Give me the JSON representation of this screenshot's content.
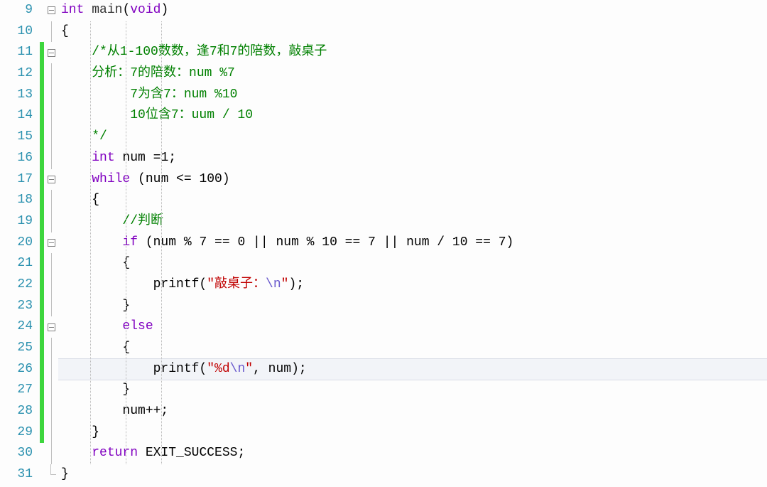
{
  "first_line_number": 9,
  "lines": [
    {
      "num": 9,
      "fold": "box",
      "changed": false,
      "tokens": [
        {
          "t": "int",
          "c": "kw"
        },
        {
          "t": " "
        },
        {
          "t": "main",
          "c": "ident"
        },
        {
          "t": "("
        },
        {
          "t": "void",
          "c": "kw"
        },
        {
          "t": ")"
        }
      ]
    },
    {
      "num": 10,
      "fold": "line",
      "changed": false,
      "tokens": [
        {
          "t": "{"
        }
      ]
    },
    {
      "num": 11,
      "fold": "box",
      "changed": true,
      "tokens": [
        {
          "t": "    "
        },
        {
          "t": "/*从1-100数数，逢7和7的陪数，敲桌子",
          "c": "comment"
        }
      ]
    },
    {
      "num": 12,
      "fold": "line",
      "changed": true,
      "tokens": [
        {
          "t": "    "
        },
        {
          "t": "分析：7的陪数：num %7",
          "c": "comment"
        }
      ]
    },
    {
      "num": 13,
      "fold": "line",
      "changed": true,
      "tokens": [
        {
          "t": "         "
        },
        {
          "t": "7为含7：num %10",
          "c": "comment"
        }
      ]
    },
    {
      "num": 14,
      "fold": "line",
      "changed": true,
      "tokens": [
        {
          "t": "         "
        },
        {
          "t": "10位含7：uum / 10",
          "c": "comment"
        }
      ]
    },
    {
      "num": 15,
      "fold": "line",
      "changed": true,
      "tokens": [
        {
          "t": "    "
        },
        {
          "t": "*/",
          "c": "comment"
        }
      ]
    },
    {
      "num": 16,
      "fold": "line",
      "changed": true,
      "tokens": [
        {
          "t": "    "
        },
        {
          "t": "int",
          "c": "kw"
        },
        {
          "t": " num ="
        },
        {
          "t": "1"
        },
        {
          "t": ";"
        }
      ]
    },
    {
      "num": 17,
      "fold": "box",
      "changed": true,
      "tokens": [
        {
          "t": "    "
        },
        {
          "t": "while",
          "c": "kw"
        },
        {
          "t": " (num <= "
        },
        {
          "t": "100"
        },
        {
          "t": ")"
        }
      ]
    },
    {
      "num": 18,
      "fold": "line",
      "changed": true,
      "tokens": [
        {
          "t": "    {"
        }
      ]
    },
    {
      "num": 19,
      "fold": "line",
      "changed": true,
      "tokens": [
        {
          "t": "        "
        },
        {
          "t": "//判断",
          "c": "comment"
        }
      ]
    },
    {
      "num": 20,
      "fold": "box",
      "changed": true,
      "tokens": [
        {
          "t": "        "
        },
        {
          "t": "if",
          "c": "kw"
        },
        {
          "t": " (num % 7 == 0 || num % 10 == 7 || num / 10 == 7)"
        }
      ]
    },
    {
      "num": 21,
      "fold": "line",
      "changed": true,
      "tokens": [
        {
          "t": "        {"
        }
      ]
    },
    {
      "num": 22,
      "fold": "line",
      "changed": true,
      "tokens": [
        {
          "t": "            printf("
        },
        {
          "t": "\"敲桌子：",
          "c": "str"
        },
        {
          "t": "\\n",
          "c": "esc"
        },
        {
          "t": "\"",
          "c": "str"
        },
        {
          "t": ");"
        }
      ]
    },
    {
      "num": 23,
      "fold": "line",
      "changed": true,
      "tokens": [
        {
          "t": "        }"
        }
      ]
    },
    {
      "num": 24,
      "fold": "box",
      "changed": true,
      "tokens": [
        {
          "t": "        "
        },
        {
          "t": "else",
          "c": "kw"
        }
      ]
    },
    {
      "num": 25,
      "fold": "line",
      "changed": true,
      "tokens": [
        {
          "t": "        {"
        }
      ]
    },
    {
      "num": 26,
      "fold": "line",
      "changed": true,
      "current": true,
      "tokens": [
        {
          "t": "            printf("
        },
        {
          "t": "\"%d",
          "c": "str"
        },
        {
          "t": "\\n",
          "c": "esc"
        },
        {
          "t": "\"",
          "c": "str"
        },
        {
          "t": ", num);"
        }
      ]
    },
    {
      "num": 27,
      "fold": "line",
      "changed": true,
      "tokens": [
        {
          "t": "        }"
        }
      ]
    },
    {
      "num": 28,
      "fold": "line",
      "changed": true,
      "tokens": [
        {
          "t": "        num++;"
        }
      ]
    },
    {
      "num": 29,
      "fold": "line",
      "changed": true,
      "tokens": [
        {
          "t": "    }"
        }
      ]
    },
    {
      "num": 30,
      "fold": "line",
      "changed": false,
      "tokens": [
        {
          "t": "    "
        },
        {
          "t": "return",
          "c": "kw"
        },
        {
          "t": " EXIT_SUCCESS;"
        }
      ]
    },
    {
      "num": 31,
      "fold": "end",
      "changed": false,
      "tokens": [
        {
          "t": "}"
        }
      ]
    }
  ],
  "indent_guide_positions": [
    41,
    91,
    141
  ]
}
